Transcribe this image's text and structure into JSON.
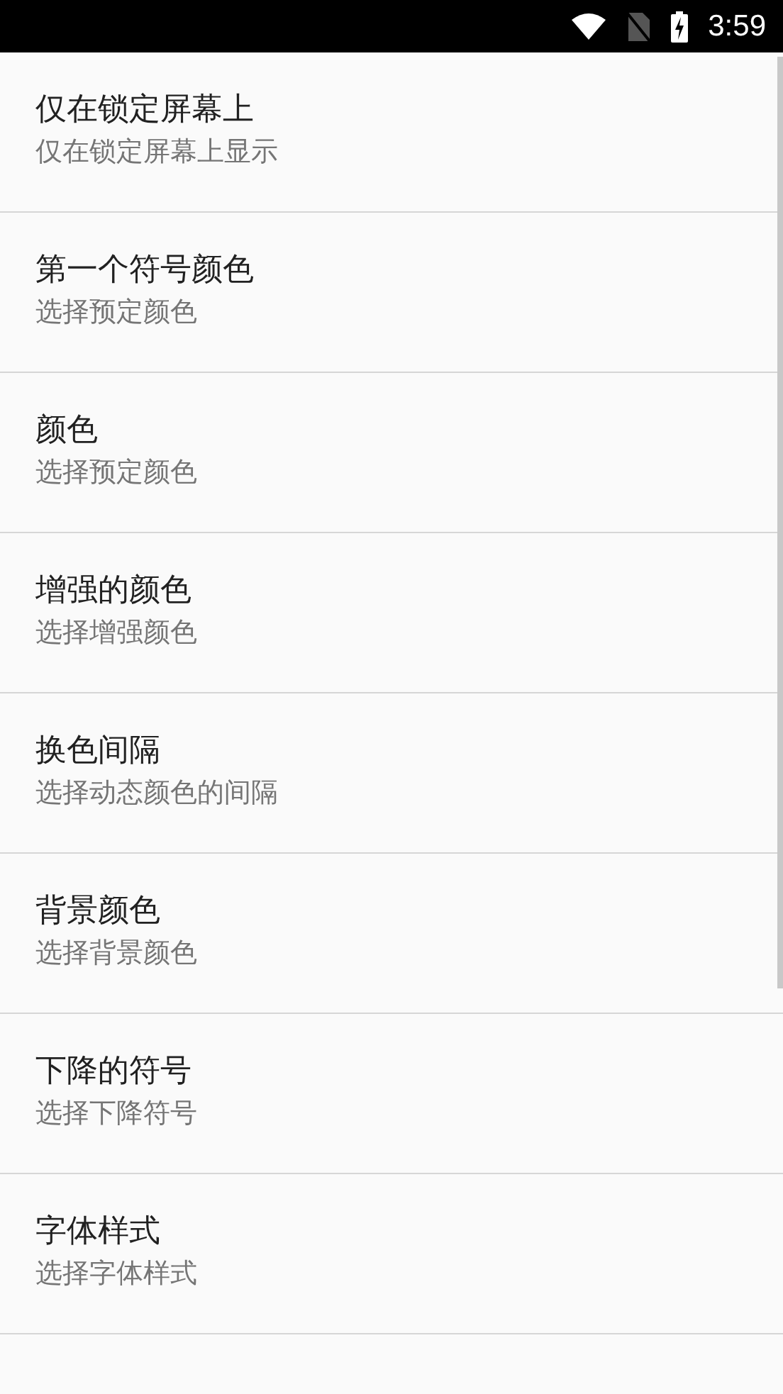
{
  "status_bar": {
    "time": "3:59"
  },
  "settings": [
    {
      "title": "仅在锁定屏幕上",
      "summary": "仅在锁定屏幕上显示"
    },
    {
      "title": "第一个符号颜色",
      "summary": "选择预定颜色"
    },
    {
      "title": "颜色",
      "summary": "选择预定颜色"
    },
    {
      "title": "增强的颜色",
      "summary": "选择增强颜色"
    },
    {
      "title": "换色间隔",
      "summary": "选择动态颜色的间隔"
    },
    {
      "title": "背景颜色",
      "summary": "选择背景颜色"
    },
    {
      "title": "下降的符号",
      "summary": "选择下降符号"
    },
    {
      "title": "字体样式",
      "summary": "选择字体样式"
    }
  ]
}
